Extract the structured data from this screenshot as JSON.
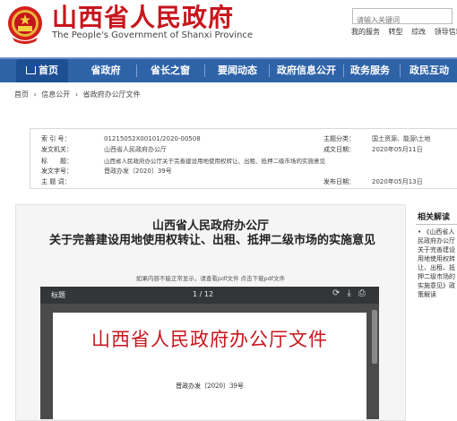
{
  "header": {
    "title": "山西省人民政府",
    "subtitle": "The People's Government of Shanxi Province",
    "search_placeholder": "请输入关键词",
    "top_links": [
      "我的服务",
      "转型",
      "综改",
      "领导信箱"
    ]
  },
  "nav": {
    "items": [
      "首页",
      "省政府",
      "省长之窗",
      "要闻动态",
      "政府信息公开",
      "政务服务",
      "政民互动"
    ]
  },
  "breadcrumb": [
    "首页",
    "›",
    "信息公开",
    "›",
    "省政府办公厅文件"
  ],
  "meta": {
    "rows": [
      {
        "key": "索 引 号：",
        "value": "01215052X00101/2020-00508"
      },
      {
        "key": "发文机关：",
        "value": "山西省人民政府办公厅"
      },
      {
        "key": "标　　题：",
        "value": "山西省人民政府办公厅关于完善建设用地使用权转让、出租、抵押二级市场的实施意见"
      },
      {
        "key": "发文字号：",
        "value": "晋政办发〔2020〕39号"
      },
      {
        "key": "主 题 词：",
        "value": ""
      }
    ],
    "right_rows": [
      {
        "key": "主题分类：",
        "value": "国土资源、能源\\土地"
      },
      {
        "key": "成文日期：",
        "value": "2020年05月11日"
      },
      {
        "key": "发布日期：",
        "value": "2020年05月13日"
      }
    ]
  },
  "content": {
    "org": "山西省人民政府办公厅",
    "title": "关于完善建设用地使用权转让、出租、抵押二级市场的实施意见",
    "pdf_hint": "如果内容不能正常显示，请查看pdf文件 点击下载pdf文件"
  },
  "pdf": {
    "name": "标题",
    "pages": "1 / 12",
    "page_heading": "山西省人民政府办公厅文件",
    "doc_number": "晋政办发〔2020〕39号"
  },
  "related": {
    "title": "相关解读",
    "items": [
      "《山西省人民政府办公厅关于完善建设用地使用权转让、出租、抵押二级市场的实施意见》政策解读"
    ]
  },
  "colors": {
    "brand_red": "#c8161d",
    "nav_blue": "#2e63a8"
  }
}
